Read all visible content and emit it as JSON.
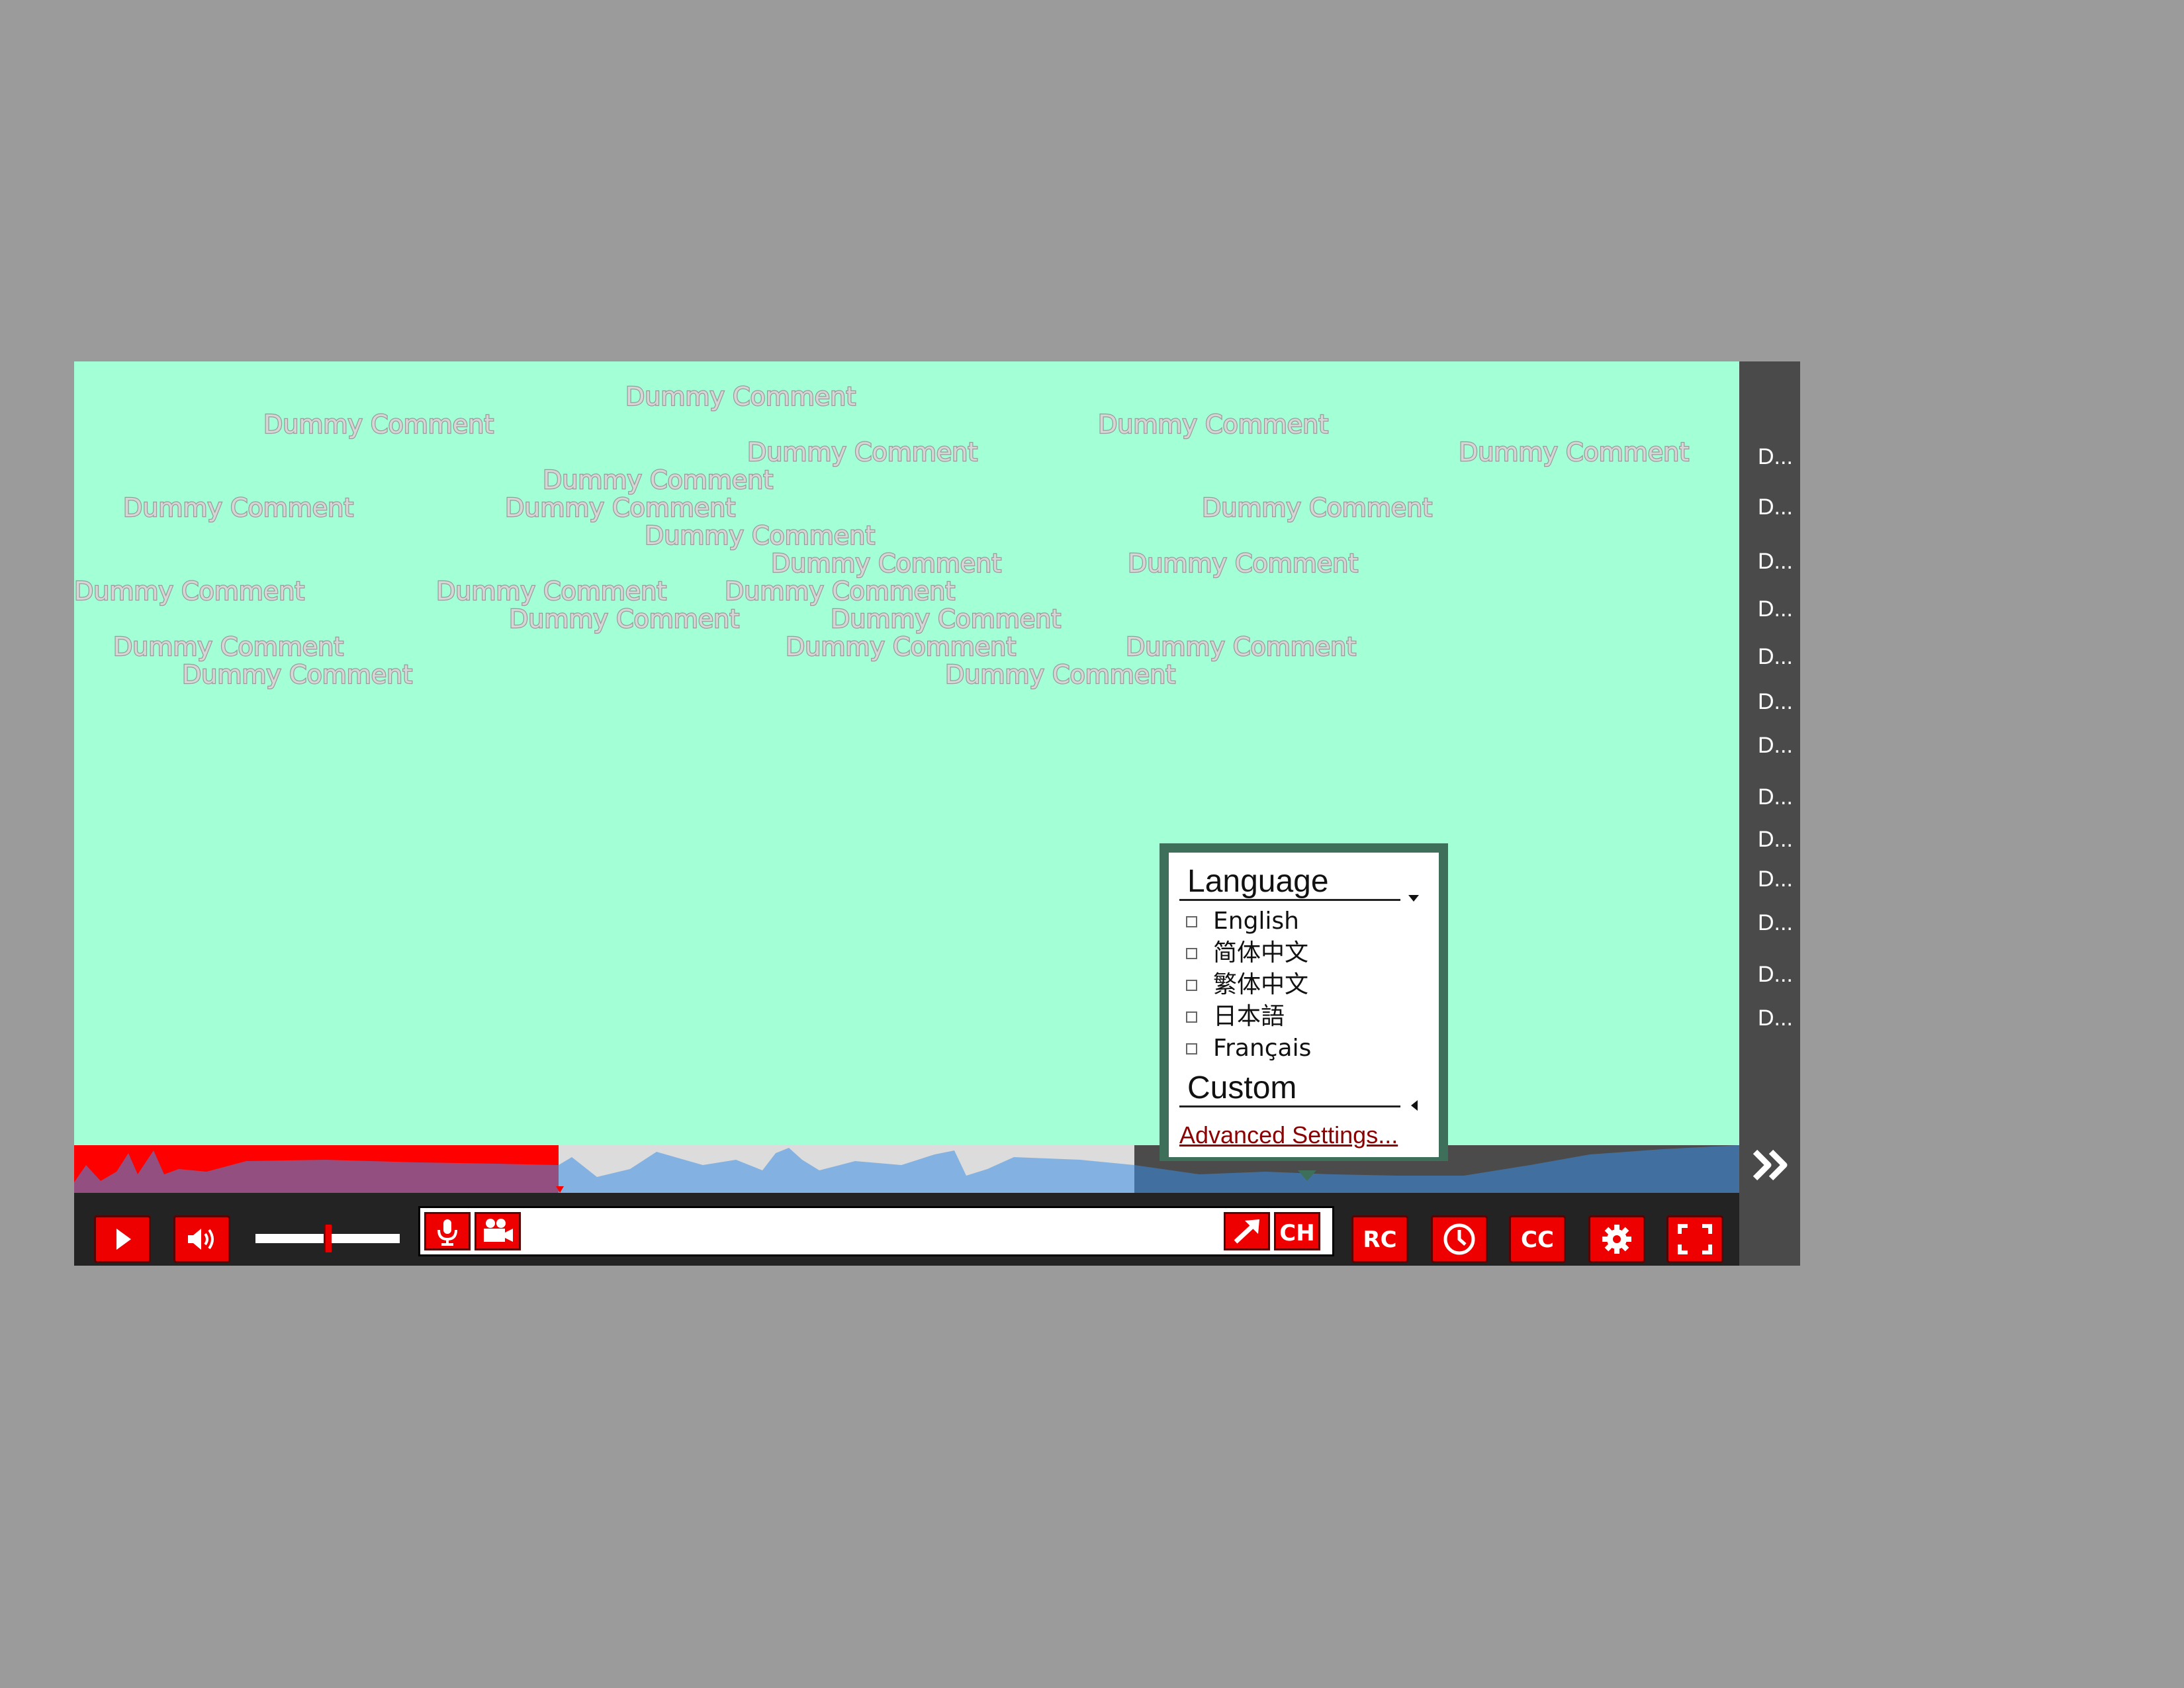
{
  "colors": {
    "background": "#9b9b9b",
    "video": "#a3ffd6",
    "sidebar": "#4a4a4a",
    "controls": "#232323",
    "accent": "#ee0000",
    "popup_frame": "#3d6f5a",
    "link": "#8b0000"
  },
  "video": {
    "comments": [
      "Dummy Comment",
      "Dummy Comment",
      "Dummy Comment",
      "Dummy Comment",
      "Dummy Comment",
      "Dummy Comment",
      "Dummy Comment",
      "Dummy Comment",
      "Dummy Comment",
      "Dummy Comment",
      "Dummy Comment",
      "Dummy Comment",
      "Dummy Comment",
      "Dummy Comment",
      "Dummy Comment",
      "Dummy Comment",
      "Dummy Comment",
      "Dummy Comment",
      "Dummy Comment",
      "Dummy Comment",
      "Dummy Comment",
      "Dummy Comment",
      "Dummy Comment"
    ]
  },
  "comment_list": {
    "items": [
      "D...",
      "D...",
      "D...",
      "D...",
      "D...",
      "D...",
      "D...",
      "D...",
      "D...",
      "D...",
      "D...",
      "D...",
      "D..."
    ],
    "expand_icon": "double-chevron-right-icon"
  },
  "controls": {
    "play_icon": "play-icon",
    "volume_icon": "volume-icon",
    "volume_level": 0.5,
    "voice_icon": "microphone-icon",
    "camera_icon": "video-camera-icon",
    "comment_input": {
      "value": "",
      "placeholder": ""
    },
    "share_icon": "arrow-up-right-icon",
    "channel_label": "CH",
    "rc_label": "RC",
    "clock_icon": "clock-icon",
    "cc_label": "CC",
    "settings_icon": "gear-icon",
    "fullscreen_icon": "fullscreen-icon"
  },
  "language_popup": {
    "language_title": "Language",
    "options": [
      "English",
      "简体中文",
      "繁体中文",
      "日本語",
      "Français"
    ],
    "custom_title": "Custom",
    "advanced_link": "Advanced Settings..."
  }
}
